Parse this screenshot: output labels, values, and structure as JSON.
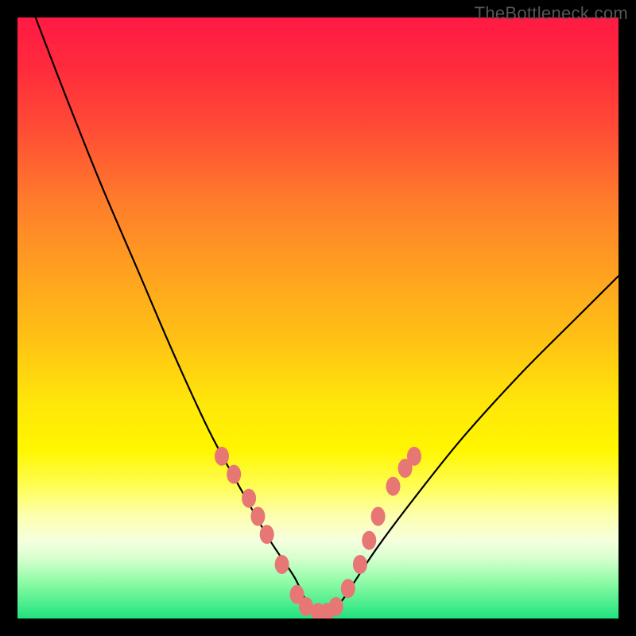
{
  "watermark": "TheBottleneck.com",
  "chart_data": {
    "type": "line",
    "title": "",
    "xlabel": "",
    "ylabel": "",
    "xlim": [
      0,
      100
    ],
    "ylim": [
      0,
      100
    ],
    "series": [
      {
        "name": "black-curve",
        "x": [
          3,
          8,
          14,
          20,
          26,
          32,
          38,
          42,
          46,
          48,
          50,
          52,
          54,
          56,
          60,
          66,
          74,
          84,
          94,
          100
        ],
        "y": [
          100,
          87,
          72,
          58,
          44,
          31,
          20,
          13,
          7,
          3,
          1,
          1,
          3,
          6,
          12,
          20,
          30,
          41,
          51,
          57
        ]
      },
      {
        "name": "pink-markers",
        "x": [
          34,
          36,
          38.5,
          40,
          41.5,
          44,
          46.5,
          48,
          50,
          51.5,
          53,
          55,
          57,
          58.5,
          60,
          62.5,
          64.5,
          66
        ],
        "y": [
          27,
          24,
          20,
          17,
          14,
          9,
          4,
          2,
          1,
          1,
          2,
          5,
          9,
          13,
          17,
          22,
          25,
          27
        ]
      }
    ],
    "marker_color": "#e77775",
    "curve_color": "#000000"
  }
}
